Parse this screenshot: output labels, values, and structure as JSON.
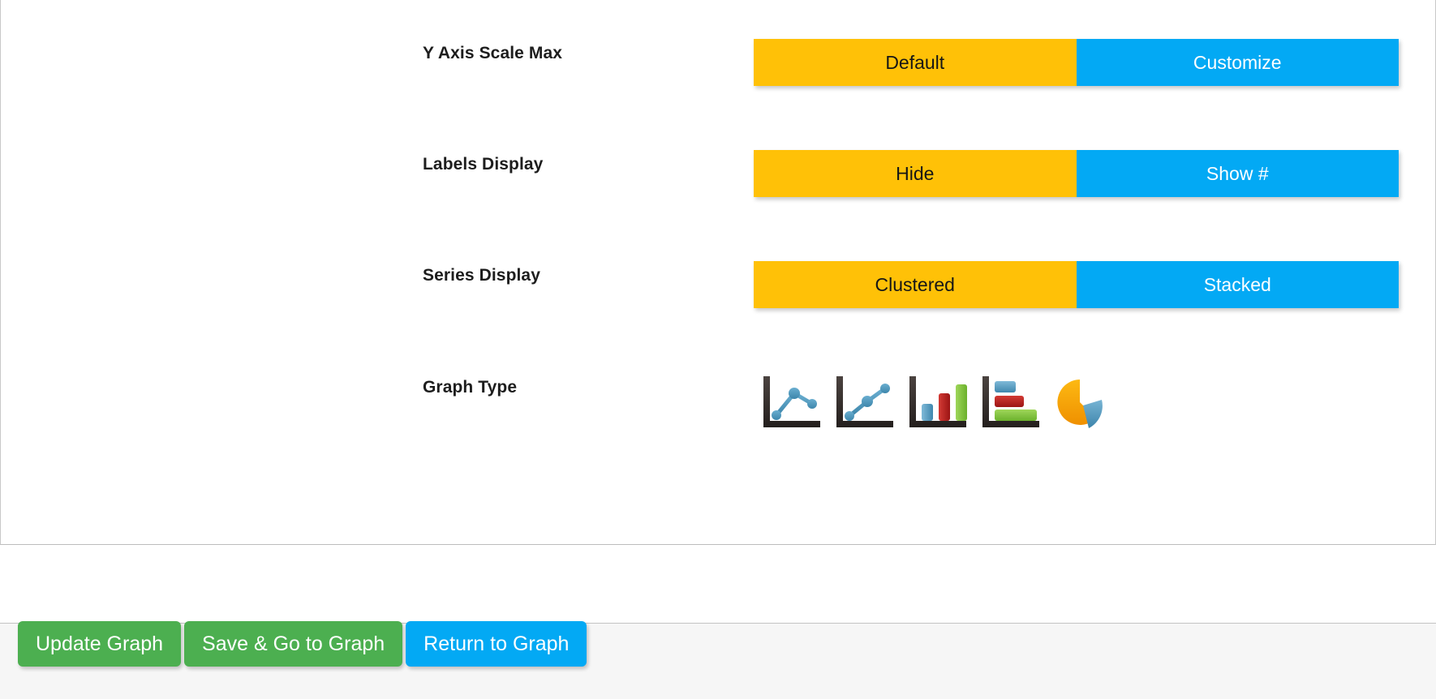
{
  "settings_rows": [
    {
      "label": "Y Axis Scale Max",
      "control": "toggle",
      "options": [
        "Default",
        "Customize"
      ],
      "selected": "Default"
    },
    {
      "label": "Labels Display",
      "control": "toggle",
      "options": [
        "Hide",
        "Show #"
      ],
      "selected": "Hide"
    },
    {
      "label": "Series Display",
      "control": "toggle",
      "options": [
        "Clustered",
        "Stacked"
      ],
      "selected": "Clustered"
    },
    {
      "label": "Graph Type",
      "control": "icon-picker",
      "icons": [
        "line-chart-icon",
        "line-chart-ascending-icon",
        "column-chart-icon",
        "bar-chart-icon",
        "pie-chart-icon"
      ]
    }
  ],
  "footer": {
    "buttons": [
      {
        "label": "Update Graph",
        "style": "green"
      },
      {
        "label": "Save & Go to Graph",
        "style": "green"
      },
      {
        "label": "Return to Graph",
        "style": "blue"
      }
    ]
  },
  "colors": {
    "selected_toggle": "#ffc107",
    "unselected_toggle": "#03a9f4",
    "primary_action": "#4caf50",
    "secondary_action": "#03a9f4",
    "icon_blue": "#4a90b8",
    "icon_red": "#b52020",
    "icon_green": "#7ac142",
    "icon_orange": "#f5a800",
    "icon_axis": "#3a3230"
  }
}
